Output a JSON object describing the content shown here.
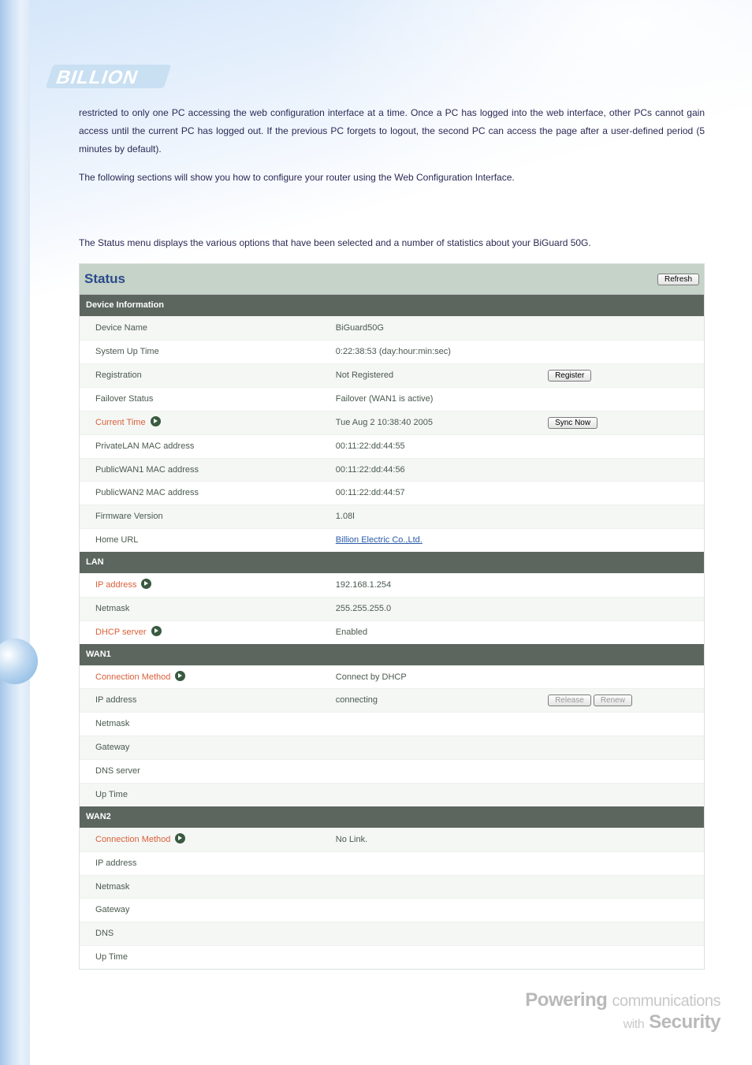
{
  "intro": {
    "p1": "restricted to only one PC accessing the web configuration interface at a time. Once a PC has logged into the web interface, other PCs cannot gain access until the current PC has logged out. If the previous PC forgets to logout, the second PC can access the page after a user-defined period (5 minutes by default).",
    "p2": "The following sections will show you how to configure your router using the Web Configuration Interface.",
    "p3": "The Status menu displays the various options that have been selected and a number of statistics about your BiGuard 50G."
  },
  "status": {
    "title": "Status",
    "refresh": "Refresh",
    "sections": {
      "device": {
        "head": "Device Information",
        "rows": {
          "device_name": {
            "label": "Device Name",
            "value": "BiGuard50G"
          },
          "uptime": {
            "label": "System Up Time",
            "value": "0:22:38:53 (day:hour:min:sec)"
          },
          "registration": {
            "label": "Registration",
            "value": "Not Registered",
            "btn": "Register"
          },
          "failover": {
            "label": "Failover Status",
            "value": "Failover (WAN1 is active)"
          },
          "current_time": {
            "label": "Current Time",
            "value": "Tue Aug 2 10:38:40 2005",
            "btn": "Sync Now"
          },
          "plan_mac": {
            "label": "PrivateLAN MAC address",
            "value": "00:11:22:dd:44:55"
          },
          "wan1_mac": {
            "label": "PublicWAN1 MAC address",
            "value": "00:11:22:dd:44:56"
          },
          "wan2_mac": {
            "label": "PublicWAN2 MAC address",
            "value": "00:11:22:dd:44:57"
          },
          "firmware": {
            "label": "Firmware Version",
            "value": "1.08l"
          },
          "home_url": {
            "label": "Home URL",
            "value": "Billion Electric Co.,Ltd."
          }
        }
      },
      "lan": {
        "head": "LAN",
        "rows": {
          "ip": {
            "label": "IP address",
            "value": "192.168.1.254"
          },
          "netmask": {
            "label": "Netmask",
            "value": "255.255.255.0"
          },
          "dhcp": {
            "label": "DHCP server",
            "value": "Enabled"
          }
        }
      },
      "wan1": {
        "head": "WAN1",
        "rows": {
          "conn": {
            "label": "Connection Method",
            "value": "Connect by DHCP"
          },
          "ip": {
            "label": "IP address",
            "value": "connecting",
            "btn1": "Release",
            "btn2": "Renew"
          },
          "netmask": {
            "label": "Netmask",
            "value": ""
          },
          "gateway": {
            "label": "Gateway",
            "value": ""
          },
          "dns": {
            "label": "DNS server",
            "value": ""
          },
          "uptime": {
            "label": "Up Time",
            "value": ""
          }
        }
      },
      "wan2": {
        "head": "WAN2",
        "rows": {
          "conn": {
            "label": "Connection Method",
            "value": "No Link."
          },
          "ip": {
            "label": "IP address",
            "value": ""
          },
          "netmask": {
            "label": "Netmask",
            "value": ""
          },
          "gateway": {
            "label": "Gateway",
            "value": ""
          },
          "dns": {
            "label": "DNS",
            "value": ""
          },
          "uptime": {
            "label": "Up Time",
            "value": ""
          }
        }
      }
    }
  },
  "footer": {
    "word1": "Powering",
    "word2": "communications",
    "word3": "with",
    "word4": "Security"
  }
}
